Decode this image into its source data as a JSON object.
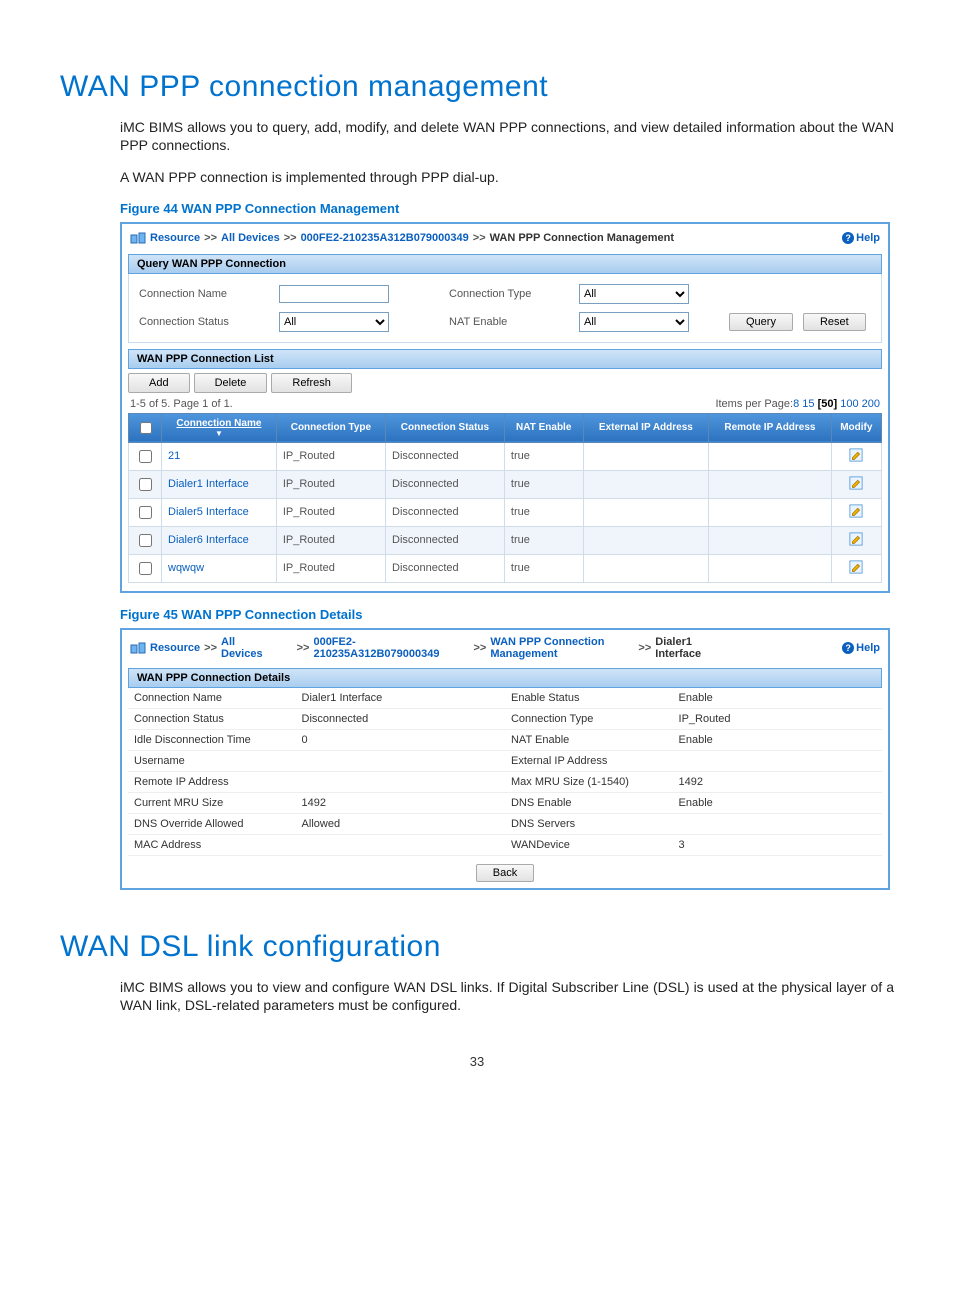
{
  "h1_ppp": "WAN PPP connection management",
  "p1": "iMC BIMS allows you to query, add, modify, and delete WAN PPP connections, and view detailed information about the WAN PPP connections.",
  "p2": "A WAN PPP connection is implemented through PPP dial-up.",
  "fig44_caption": "Figure 44 WAN PPP Connection Management",
  "fig44": {
    "breadcrumb": {
      "resource": "Resource",
      "all_devices": "All Devices",
      "device_id": "000FE2-210235A312B079000349",
      "current": "WAN PPP Connection Management",
      "sep": ">>",
      "help": "Help"
    },
    "query_header": "Query WAN PPP Connection",
    "form": {
      "conn_name_label": "Connection Name",
      "conn_name_value": "",
      "conn_type_label": "Connection Type",
      "conn_type_value": "All",
      "conn_status_label": "Connection Status",
      "conn_status_value": "All",
      "nat_enable_label": "NAT Enable",
      "nat_enable_value": "All",
      "query_btn": "Query",
      "reset_btn": "Reset"
    },
    "list_header": "WAN PPP Connection List",
    "toolbar": {
      "add": "Add",
      "delete": "Delete",
      "refresh": "Refresh"
    },
    "page_info": "1-5 of 5. Page 1 of 1.",
    "items_per_page_label": "Items per Page:",
    "ipp_options": [
      "8",
      "15",
      "[50]",
      "100",
      "200"
    ],
    "columns": [
      "Connection Name",
      "Connection Type",
      "Connection Status",
      "NAT Enable",
      "External IP Address",
      "Remote IP Address",
      "Modify"
    ],
    "rows": [
      {
        "name": "21",
        "type": "IP_Routed",
        "status": "Disconnected",
        "nat": "true",
        "ext": "",
        "remote": ""
      },
      {
        "name": "Dialer1 Interface",
        "type": "IP_Routed",
        "status": "Disconnected",
        "nat": "true",
        "ext": "",
        "remote": ""
      },
      {
        "name": "Dialer5 Interface",
        "type": "IP_Routed",
        "status": "Disconnected",
        "nat": "true",
        "ext": "",
        "remote": ""
      },
      {
        "name": "Dialer6 Interface",
        "type": "IP_Routed",
        "status": "Disconnected",
        "nat": "true",
        "ext": "",
        "remote": ""
      },
      {
        "name": "wqwqw",
        "type": "IP_Routed",
        "status": "Disconnected",
        "nat": "true",
        "ext": "",
        "remote": ""
      }
    ]
  },
  "fig45_caption": "Figure 45 WAN PPP Connection Details",
  "fig45": {
    "breadcrumb": {
      "resource": "Resource",
      "all_devices_l1": "All",
      "all_devices_l2": "Devices",
      "device_l1": "000FE2-",
      "device_l2": "210235A312B079000349",
      "mgmt_l1": "WAN PPP Connection",
      "mgmt_l2": "Management",
      "current_l1": "Dialer1",
      "current_l2": "Interface",
      "sep": ">>",
      "help": "Help"
    },
    "details_header": "WAN PPP Connection Details",
    "details": {
      "conn_name_l": "Connection Name",
      "conn_name_v": "Dialer1 Interface",
      "enable_status_l": "Enable Status",
      "enable_status_v": "Enable",
      "conn_status_l": "Connection Status",
      "conn_status_v": "Disconnected",
      "conn_type_l": "Connection Type",
      "conn_type_v": "IP_Routed",
      "idle_l": "Idle Disconnection Time",
      "idle_v": "0",
      "nat_l": "NAT Enable",
      "nat_v": "Enable",
      "user_l": "Username",
      "user_v": "",
      "ext_l": "External IP Address",
      "ext_v": "",
      "remote_l": "Remote IP Address",
      "remote_v": "",
      "maxmru_l": "Max MRU Size (1-1540)",
      "maxmru_v": "1492",
      "curmru_l": "Current MRU Size",
      "curmru_v": "1492",
      "dnse_l": "DNS Enable",
      "dnse_v": "Enable",
      "dnso_l": "DNS Override Allowed",
      "dnso_v": "Allowed",
      "dnss_l": "DNS Servers",
      "dnss_v": "",
      "mac_l": "MAC Address",
      "mac_v": "",
      "wan_l": "WANDevice",
      "wan_v": "3"
    },
    "back_btn": "Back"
  },
  "h1_dsl": "WAN DSL link configuration",
  "p3": "iMC BIMS allows you to view and configure WAN DSL links. If Digital Subscriber Line (DSL) is used at the physical layer of a WAN link, DSL-related parameters must be configured.",
  "page_number": "33"
}
